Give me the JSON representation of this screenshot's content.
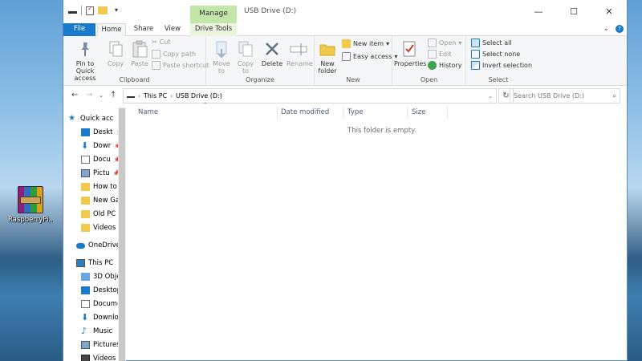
{
  "desktop": {
    "icon_label": "RaspberryPi..."
  },
  "window": {
    "manage_tab": "Manage",
    "title": "USB Drive (D:)",
    "controls": {
      "minimize": "—",
      "maximize": "☐",
      "close": "✕"
    }
  },
  "tabs": {
    "file": "File",
    "home": "Home",
    "share": "Share",
    "view": "View",
    "drive_tools": "Drive Tools"
  },
  "ribbon": {
    "clipboard": {
      "label": "Clipboard",
      "pin": "Pin to Quick access",
      "copy": "Copy",
      "paste": "Paste",
      "cut": "Cut",
      "copy_path": "Copy path",
      "paste_shortcut": "Paste shortcut"
    },
    "organize": {
      "label": "Organize",
      "move_to": "Move to",
      "copy_to": "Copy to",
      "delete": "Delete",
      "rename": "Rename"
    },
    "new": {
      "label": "New",
      "new_folder": "New folder",
      "new_item": "New item",
      "easy_access": "Easy access"
    },
    "open": {
      "label": "Open",
      "properties": "Properties",
      "open": "Open",
      "edit": "Edit",
      "history": "History"
    },
    "select": {
      "label": "Select",
      "select_all": "Select all",
      "select_none": "Select none",
      "invert_selection": "Invert selection"
    }
  },
  "address": {
    "path": [
      "This PC",
      "USB Drive (D:)"
    ],
    "search_placeholder": "Search USB Drive (D:)"
  },
  "nav": {
    "quick_access": "Quick acc",
    "items": [
      "Deskt",
      "Dowr",
      "Docu",
      "Pictu",
      "How to",
      "New Ga",
      "Old PC",
      "Videos"
    ],
    "onedrive": "OneDrive",
    "this_pc": "This PC",
    "pc_items": [
      "3D Obje",
      "Desktop",
      "Docume",
      "Downlo",
      "Music",
      "Pictures",
      "Videos"
    ]
  },
  "columns": {
    "name": "Name",
    "date": "Date modified",
    "type": "Type",
    "size": "Size"
  },
  "empty_text": "This folder is empty.",
  "colors": {
    "accent": "#1979ca",
    "manage": "#c3e6a9",
    "folder": "#f2c94c"
  }
}
